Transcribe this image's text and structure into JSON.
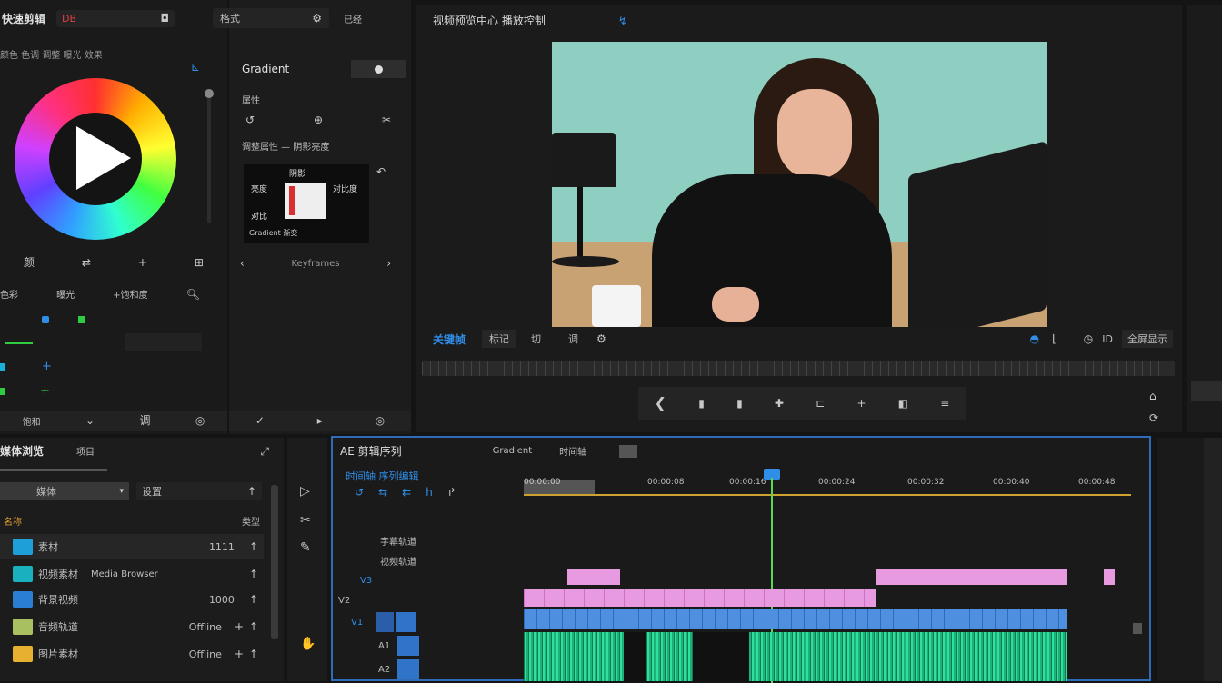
{
  "left_panel": {
    "tab_title": "快速剪辑",
    "tab_a": "DB",
    "tab_b": "格式",
    "tab_c": "已经",
    "subheader": "颜色 色调 调整 曝光 效果",
    "bottom_row": [
      "颜",
      "⇄",
      "+",
      "⊞"
    ],
    "list_row1": [
      "色彩",
      "曝光",
      "+饱和度"
    ],
    "bottom_bar": [
      "饱和",
      "⌄",
      "调",
      "◎",
      "✓",
      "▸",
      "◎"
    ]
  },
  "properties": {
    "title": "Gradient",
    "line1": "属性",
    "line2": "调整属性 — 阴影亮度",
    "thumb_label_top": "阴影",
    "thumb_label_l1": "亮度",
    "thumb_label_l2": "对比",
    "thumb_label_r1": "对比度",
    "thumb_bottom": "Gradient 渐变",
    "nav_label": "Keyframes"
  },
  "program_monitor": {
    "title": "视频预览中心 播放控制",
    "title_icon": "↯",
    "toolbar_label": "关键帧",
    "toolbar_btn1": "标记",
    "toolbar_btn2": "切",
    "toolbar_btn3": "调",
    "right_label": "全屏显示",
    "right_icon2": "▭",
    "quality": "ID",
    "transport": [
      "❮",
      "▮",
      "▮",
      "✚",
      "⊏",
      "+",
      "◧",
      "≡"
    ]
  },
  "project_panel": {
    "title": "媒体浏览",
    "tab2": "项目",
    "search_label": "媒体",
    "search_right": "设置",
    "list_header": "名称",
    "list_header_right": "类型",
    "items": [
      {
        "name": "素材",
        "value": "1111",
        "color": "#1e9fd8"
      },
      {
        "name": "视频素材",
        "extra": "Media Browser",
        "value": "",
        "color": "#1ab0c0"
      },
      {
        "name": "背景视频",
        "extra": "",
        "value": "1000",
        "color": "#2a7fd4"
      },
      {
        "name": "音频轨道",
        "extra": "",
        "value": "Offline",
        "color": "#a8c060"
      },
      {
        "name": "图片素材",
        "extra": "",
        "value": "Offline",
        "color": "#e8b030"
      }
    ]
  },
  "timeline": {
    "title": "AE 剪辑序列",
    "tab2": "Gradient",
    "tab3": "时间轴",
    "timecode": "时间轴 序列编辑",
    "tick_labels": [
      "00:00:00",
      "00:00:08",
      "00:00:16",
      "00:00:24",
      "00:00:32",
      "00:00:40",
      "00:00:48"
    ],
    "track_labels": [
      "字幕轨道",
      "视频轨道",
      "V3",
      "V2",
      "V1",
      "A1",
      "A2"
    ]
  }
}
